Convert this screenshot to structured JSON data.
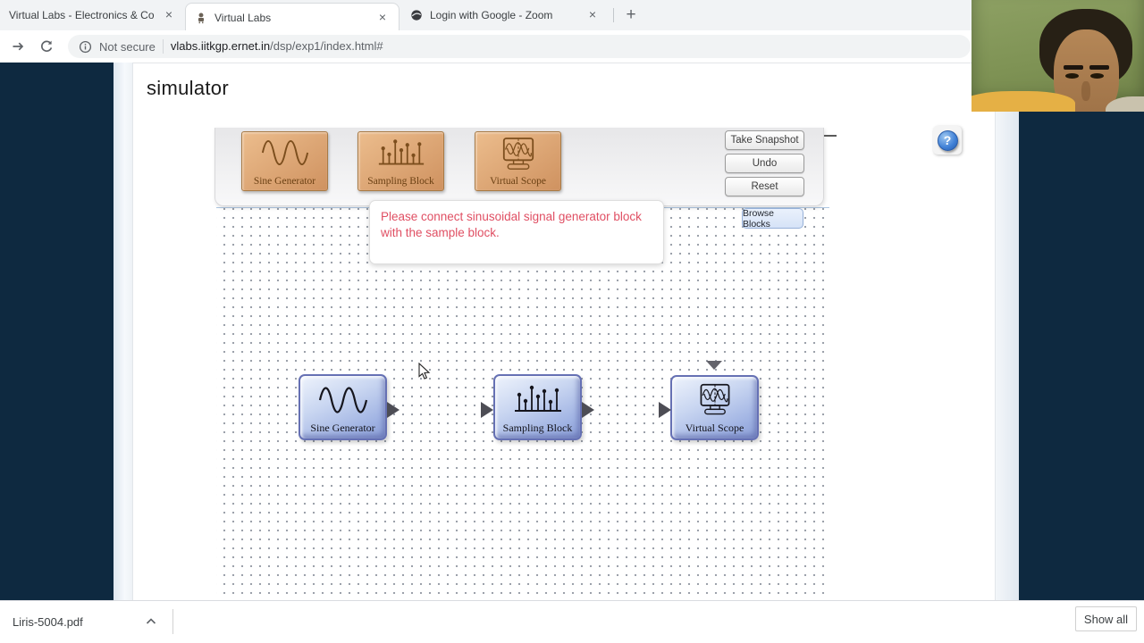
{
  "browser": {
    "tabs": [
      {
        "title": "Virtual Labs - Electronics & Com"
      },
      {
        "title": "Virtual Labs"
      },
      {
        "title": "Login with Google - Zoom"
      }
    ],
    "close_label": "×",
    "new_tab_label": "+",
    "address": {
      "security_label": "Not secure",
      "url_domain": "vlabs.iitkgp.ernet.in",
      "url_path": "/dsp/exp1/index.html#"
    }
  },
  "page": {
    "title": "simulator",
    "help_glyph": "?",
    "palette": [
      {
        "label": "Sine Generator",
        "icon": "sine-wave-icon"
      },
      {
        "label": "Sampling Block",
        "icon": "stem-plot-icon"
      },
      {
        "label": "Virtual Scope",
        "icon": "oscilloscope-icon"
      }
    ],
    "toolbar_buttons": [
      {
        "label": "Take Snapshot"
      },
      {
        "label": "Undo"
      },
      {
        "label": "Reset"
      }
    ],
    "browse_blocks_label": "Browse Blocks",
    "message": {
      "line1": "Please connect sinusoidal signal generator block",
      "line2": "with the sample block."
    },
    "canvas_blocks": [
      {
        "label": "Sine Generator",
        "icon": "sine-wave-icon"
      },
      {
        "label": "Sampling Block",
        "icon": "stem-plot-icon"
      },
      {
        "label": "Virtual Scope",
        "icon": "oscilloscope-icon"
      }
    ]
  },
  "download_bar": {
    "file_name": "Liris-5004.pdf",
    "show_all_label": "Show all"
  },
  "colors": {
    "side_strip": "#0e2940",
    "palette_block": "#d9a273",
    "canvas_block": "#a9bce7",
    "message_text": "#e04f63",
    "help_accent": "#3e7fd6"
  }
}
